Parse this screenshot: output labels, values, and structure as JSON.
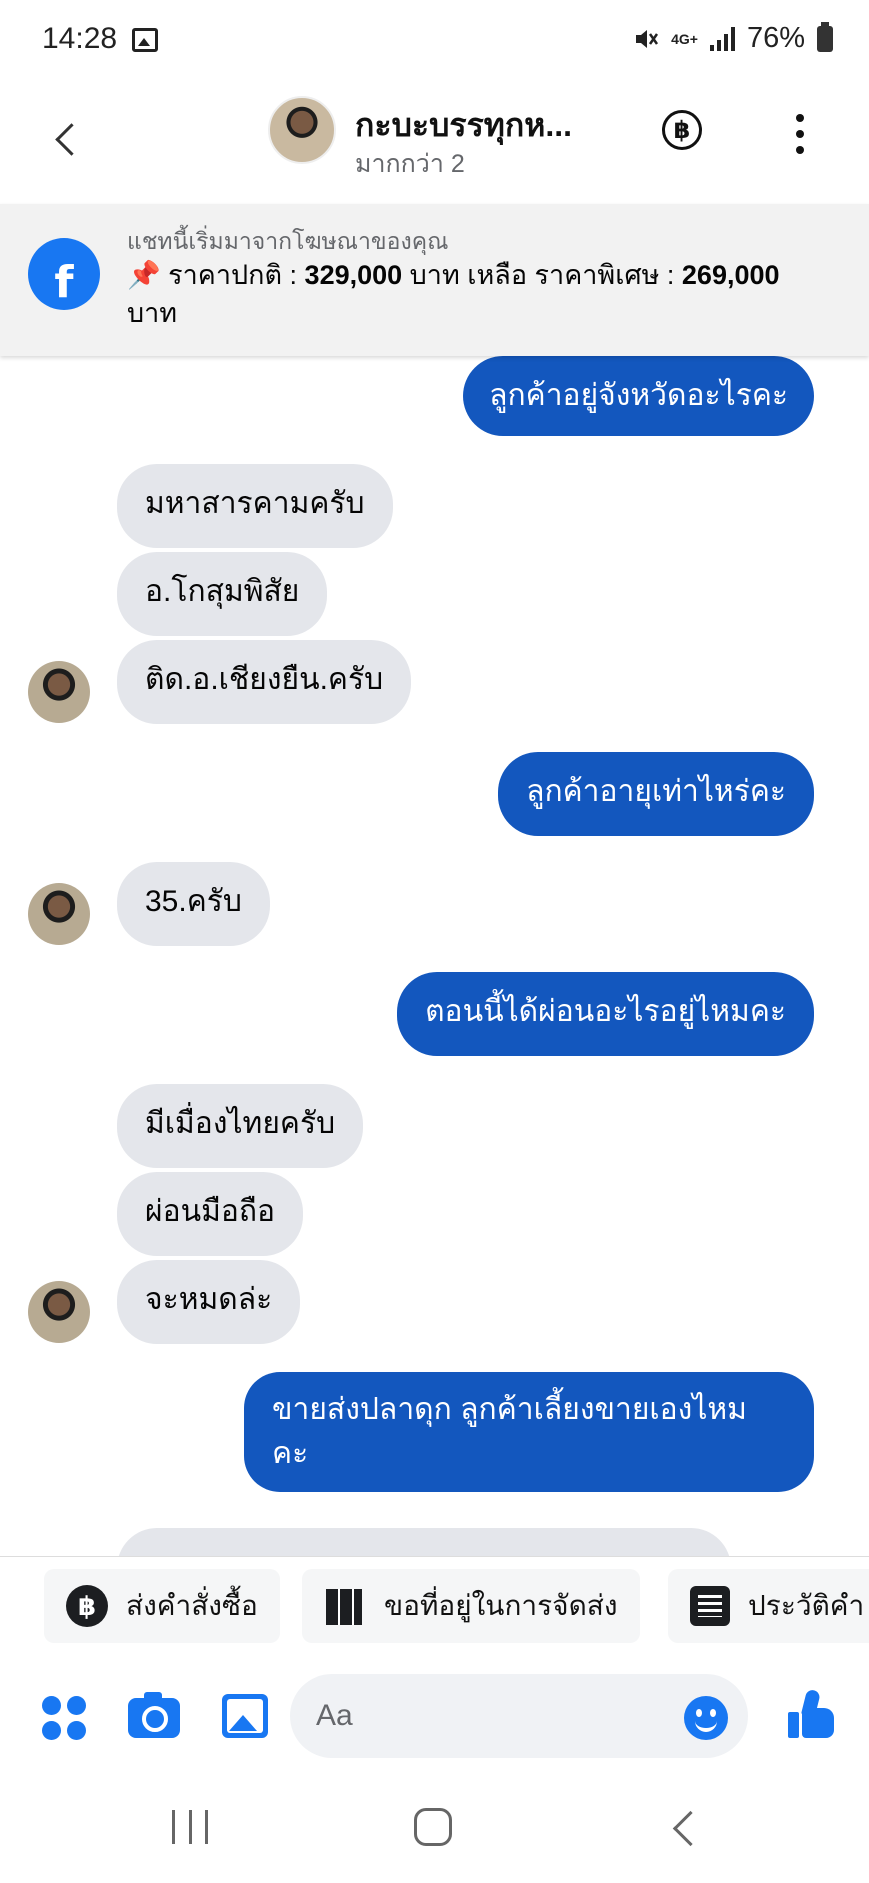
{
  "status_bar": {
    "time": "14:28",
    "network": "4G+",
    "battery": "76%"
  },
  "header": {
    "name": "กะบะบรรทุกห...",
    "subtitle": "มากกว่า 2",
    "baht_symbol": "฿"
  },
  "ad_banner": {
    "caption": "แชทนี้เริ่มมาจากโฆษณาของคุณ",
    "pin": "📌",
    "text_part1": " ราคาปกติ : ",
    "price_normal": "329,000",
    "text_part2": " บาท เหลือ ราคาพิเศษ : ",
    "price_special": "269,000",
    "text_part3": " บาท"
  },
  "messages": [
    {
      "direction": "out",
      "text": "ลูกค้าอยู่จังหวัดอะไรคะ"
    },
    {
      "direction": "in",
      "text": "มหาสารคามครับ"
    },
    {
      "direction": "in",
      "text": "อ.โกสุมพิสัย"
    },
    {
      "direction": "in",
      "text": "ติด.อ.เชียงยืน.ครับ"
    },
    {
      "direction": "out",
      "text": "ลูกค้าอายุเท่าไหร่คะ"
    },
    {
      "direction": "in",
      "text": "35.ครับ"
    },
    {
      "direction": "out",
      "text": "ตอนนี้ได้ผ่อนอะไรอยู่ไหมคะ"
    },
    {
      "direction": "in",
      "text": "มีเมื่องไทยครับ"
    },
    {
      "direction": "in",
      "text": "ผ่อนมือถือ"
    },
    {
      "direction": "in",
      "text": "จะหมดล่ะ"
    },
    {
      "direction": "out",
      "text_line1": "ขายส่งปลาดุก ลูกค้าเลี้ยงขายเองไหม",
      "text_line2": "คะ"
    }
  ],
  "quick_actions": [
    {
      "label": "ส่งคำสั่งซื้อ",
      "icon": "baht-icon",
      "glyph": "฿"
    },
    {
      "label": "ขอที่อยู่ในการจัดส่ง",
      "icon": "map-icon"
    },
    {
      "label": "ประวัติคำ",
      "icon": "list-icon"
    }
  ],
  "composer": {
    "placeholder": "Aa"
  },
  "colors": {
    "outgoing_bubble": "#1357be",
    "incoming_bubble": "#e4e6eb",
    "accent": "#1877f2"
  }
}
